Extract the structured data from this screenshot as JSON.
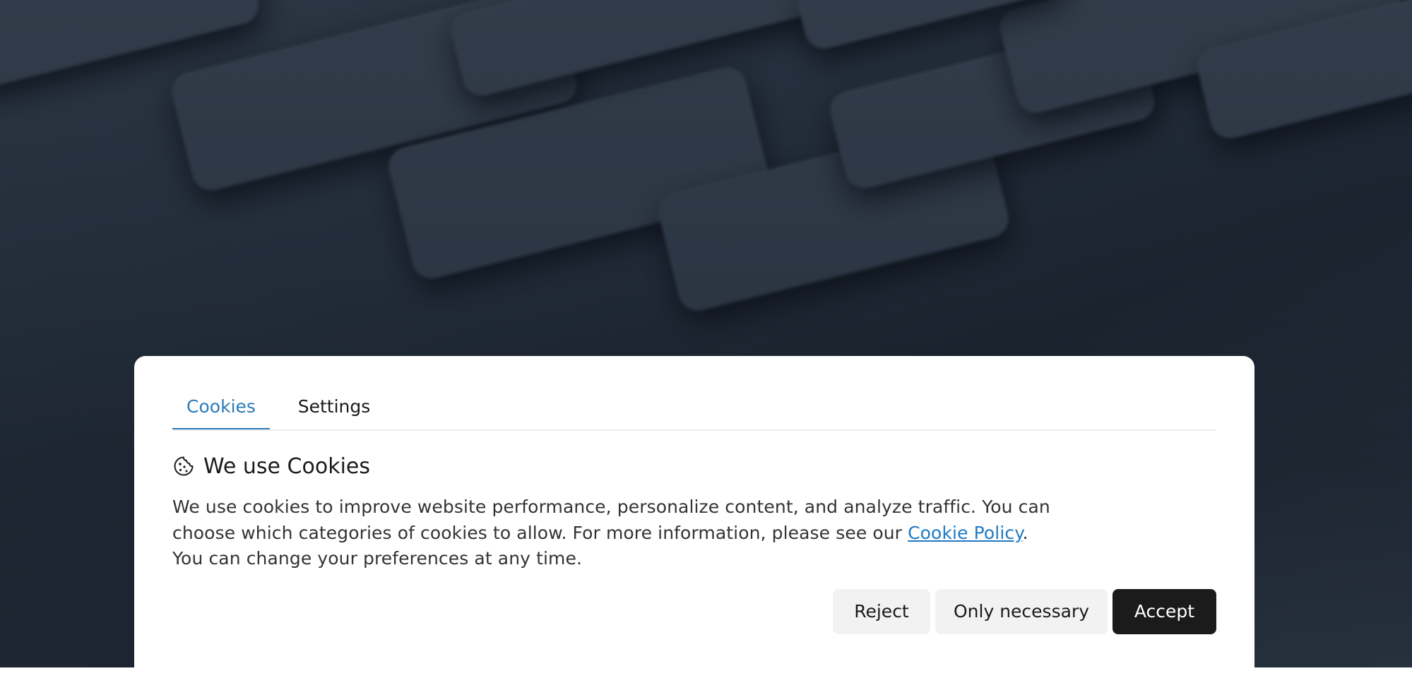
{
  "tabs": {
    "cookies": "Cookies",
    "settings": "Settings"
  },
  "banner": {
    "icon": "cookie-icon",
    "title": "We use Cookies",
    "text_before": "We use cookies to improve website performance, personalize content, and analyze traffic. You can choose which categories of cookies to allow. For more information, please see our ",
    "link_text": "Cookie Policy",
    "text_after": ". You can change your preferences at any time."
  },
  "buttons": {
    "reject": "Reject",
    "only_necessary": "Only necessary",
    "accept": "Accept"
  },
  "colors": {
    "accent": "#2b7bb9",
    "link": "#1f7ac4",
    "accept_bg": "#1b1b1b",
    "secondary_bg": "#f2f2f2"
  }
}
